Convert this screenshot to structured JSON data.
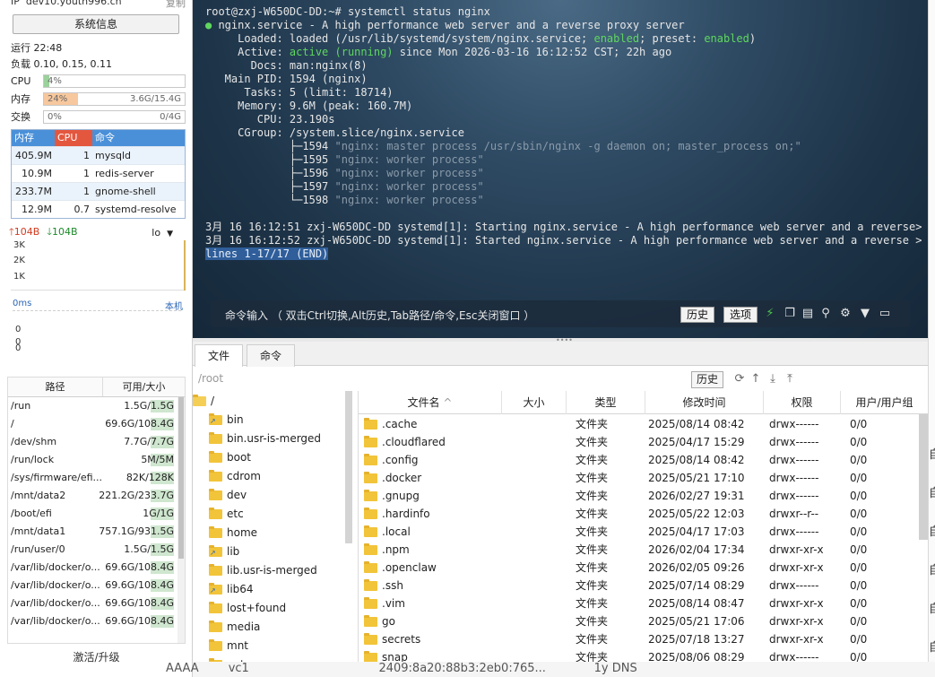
{
  "sidebar": {
    "ip_label": "IP",
    "ip_value": "dev10.youth996.cn",
    "copy_label": "复制",
    "sysinfo_button": "系统信息",
    "uptime": "运行 22:48",
    "load": "负载 0.10, 0.15, 0.11",
    "meters": [
      {
        "label": "CPU",
        "percent": "4%",
        "value": "",
        "fill": 0.04,
        "color": "#9bd19b"
      },
      {
        "label": "内存",
        "percent": "24%",
        "value": "3.6G/15.4G",
        "fill": 0.24,
        "color": "#f7c89e"
      },
      {
        "label": "交换",
        "percent": "0%",
        "value": "0/4G",
        "fill": 0.0,
        "color": "#9bd19b"
      }
    ],
    "process_headers": [
      "内存",
      "CPU",
      "命令"
    ],
    "processes": [
      {
        "mem": "405.9M",
        "cpu": "1",
        "cmd": "mysqld"
      },
      {
        "mem": "10.9M",
        "cpu": "1",
        "cmd": "redis-server"
      },
      {
        "mem": "233.7M",
        "cpu": "1",
        "cmd": "gnome-shell"
      },
      {
        "mem": "12.9M",
        "cpu": "0.7",
        "cmd": "systemd-resolve"
      }
    ],
    "net_up": "104B",
    "net_down": "104B",
    "net_iface": "lo",
    "net_ticks": [
      "3K",
      "2K",
      "1K"
    ],
    "latency_label": "0ms",
    "host_label": "本机",
    "latency_ticks": [
      "0",
      "0",
      "0"
    ],
    "disk_headers": [
      "路径",
      "可用/大小"
    ],
    "disks": [
      {
        "path": "/run",
        "size": "1.5G/1.5G"
      },
      {
        "path": "/",
        "size": "69.6G/108.4G"
      },
      {
        "path": "/dev/shm",
        "size": "7.7G/7.7G"
      },
      {
        "path": "/run/lock",
        "size": "5M/5M"
      },
      {
        "path": "/sys/firmware/efi...",
        "size": "82K/128K"
      },
      {
        "path": "/mnt/data2",
        "size": "221.2G/233.7G"
      },
      {
        "path": "/boot/efi",
        "size": "1G/1G"
      },
      {
        "path": "/mnt/data1",
        "size": "757.1G/931.5G"
      },
      {
        "path": "/run/user/0",
        "size": "1.5G/1.5G"
      },
      {
        "path": "/var/lib/docker/o...",
        "size": "69.6G/108.4G"
      },
      {
        "path": "/var/lib/docker/o...",
        "size": "69.6G/108.4G"
      },
      {
        "path": "/var/lib/docker/o...",
        "size": "69.6G/108.4G"
      },
      {
        "path": "/var/lib/docker/o...",
        "size": "69.6G/108.4G"
      }
    ],
    "upgrade_label": "激活/升级"
  },
  "terminal": {
    "lines": [
      {
        "t": "root@zxj-W650DC-DD:~# systemctl status nginx"
      },
      {
        "t": "● nginx.service - A high performance web server and a reverse proxy server",
        "bullet": true
      },
      {
        "t": "     Loaded: loaded (/usr/lib/systemd/system/nginx.service; enabled; preset: enabled)",
        "loaded": true
      },
      {
        "t": "     Active: active (running) since Mon 2026-03-16 16:12:52 CST; 22h ago",
        "active": true
      },
      {
        "t": "       Docs: man:nginx(8)"
      },
      {
        "t": "   Main PID: 1594 (nginx)"
      },
      {
        "t": "      Tasks: 5 (limit: 18714)"
      },
      {
        "t": "     Memory: 9.6M (peak: 160.7M)"
      },
      {
        "t": "        CPU: 23.190s"
      },
      {
        "t": "     CGroup: /system.slice/nginx.service"
      },
      {
        "t": "             ├─1594 \"nginx: master process /usr/sbin/nginx -g daemon on; master_process on;\"",
        "dim": true
      },
      {
        "t": "             ├─1595 \"nginx: worker process\"",
        "dim": true
      },
      {
        "t": "             ├─1596 \"nginx: worker process\"",
        "dim": true
      },
      {
        "t": "             ├─1597 \"nginx: worker process\"",
        "dim": true
      },
      {
        "t": "             └─1598 \"nginx: worker process\"",
        "dim": true
      },
      {
        "t": ""
      },
      {
        "t": "3月 16 16:12:51 zxj-W650DC-DD systemd[1]: Starting nginx.service - A high performance web server and a reverse>"
      },
      {
        "t": "3月 16 16:12:52 zxj-W650DC-DD systemd[1]: Started nginx.service - A high performance web server and a reverse >"
      },
      {
        "t": "lines 1-17/17 (END)",
        "sel": true
      }
    ],
    "cmd_hint": "命令输入 （ 双击Ctrl切换,Alt历史,Tab路径/命令,Esc关闭窗口 ）",
    "history_button": "历史",
    "options_button": "选项"
  },
  "files": {
    "tabs": [
      "文件",
      "命令"
    ],
    "path": "/root",
    "history_button": "历史",
    "tree": [
      {
        "name": "/",
        "root": true
      },
      {
        "name": "bin",
        "link": true
      },
      {
        "name": "bin.usr-is-merged"
      },
      {
        "name": "boot"
      },
      {
        "name": "cdrom"
      },
      {
        "name": "dev"
      },
      {
        "name": "etc"
      },
      {
        "name": "home"
      },
      {
        "name": "lib",
        "link": true
      },
      {
        "name": "lib.usr-is-merged"
      },
      {
        "name": "lib64",
        "link": true
      },
      {
        "name": "lost+found"
      },
      {
        "name": "media"
      },
      {
        "name": "mnt"
      },
      {
        "name": "opt"
      }
    ],
    "columns": [
      "文件名",
      "大小",
      "类型",
      "修改时间",
      "权限",
      "用户/用户组"
    ],
    "sort_indicator": "^",
    "rows": [
      {
        "name": ".cache",
        "size": "",
        "type": "文件夹",
        "mtime": "2025/08/14 08:42",
        "perm": "drwx------",
        "owner": "0/0"
      },
      {
        "name": ".cloudflared",
        "size": "",
        "type": "文件夹",
        "mtime": "2025/04/17 15:29",
        "perm": "drwx------",
        "owner": "0/0"
      },
      {
        "name": ".config",
        "size": "",
        "type": "文件夹",
        "mtime": "2025/08/14 08:42",
        "perm": "drwx------",
        "owner": "0/0"
      },
      {
        "name": ".docker",
        "size": "",
        "type": "文件夹",
        "mtime": "2025/05/21 17:10",
        "perm": "drwx------",
        "owner": "0/0"
      },
      {
        "name": ".gnupg",
        "size": "",
        "type": "文件夹",
        "mtime": "2026/02/27 19:31",
        "perm": "drwx------",
        "owner": "0/0"
      },
      {
        "name": ".hardinfo",
        "size": "",
        "type": "文件夹",
        "mtime": "2025/05/22 12:03",
        "perm": "drwxr--r--",
        "owner": "0/0"
      },
      {
        "name": ".local",
        "size": "",
        "type": "文件夹",
        "mtime": "2025/04/17 17:03",
        "perm": "drwx------",
        "owner": "0/0"
      },
      {
        "name": ".npm",
        "size": "",
        "type": "文件夹",
        "mtime": "2026/02/04 17:34",
        "perm": "drwxr-xr-x",
        "owner": "0/0"
      },
      {
        "name": ".openclaw",
        "size": "",
        "type": "文件夹",
        "mtime": "2026/02/05 09:26",
        "perm": "drwxr-xr-x",
        "owner": "0/0"
      },
      {
        "name": ".ssh",
        "size": "",
        "type": "文件夹",
        "mtime": "2025/07/14 08:29",
        "perm": "drwx------",
        "owner": "0/0"
      },
      {
        "name": ".vim",
        "size": "",
        "type": "文件夹",
        "mtime": "2025/08/14 08:47",
        "perm": "drwxr-xr-x",
        "owner": "0/0"
      },
      {
        "name": "go",
        "size": "",
        "type": "文件夹",
        "mtime": "2025/05/21 17:06",
        "perm": "drwxr-xr-x",
        "owner": "0/0"
      },
      {
        "name": "secrets",
        "size": "",
        "type": "文件夹",
        "mtime": "2025/07/18 13:27",
        "perm": "drwxr-xr-x",
        "owner": "0/0"
      },
      {
        "name": "snap",
        "size": "",
        "type": "文件夹",
        "mtime": "2025/08/06 08:29",
        "perm": "drwx------",
        "owner": "0/0"
      }
    ]
  },
  "background": {
    "right_chars": [
      "自",
      "自",
      "自",
      "自",
      "自",
      "自"
    ],
    "bottom_text": "AAAA        vc1                                   2409:8a20:88b3:2eb0:765...             1y DNS"
  }
}
